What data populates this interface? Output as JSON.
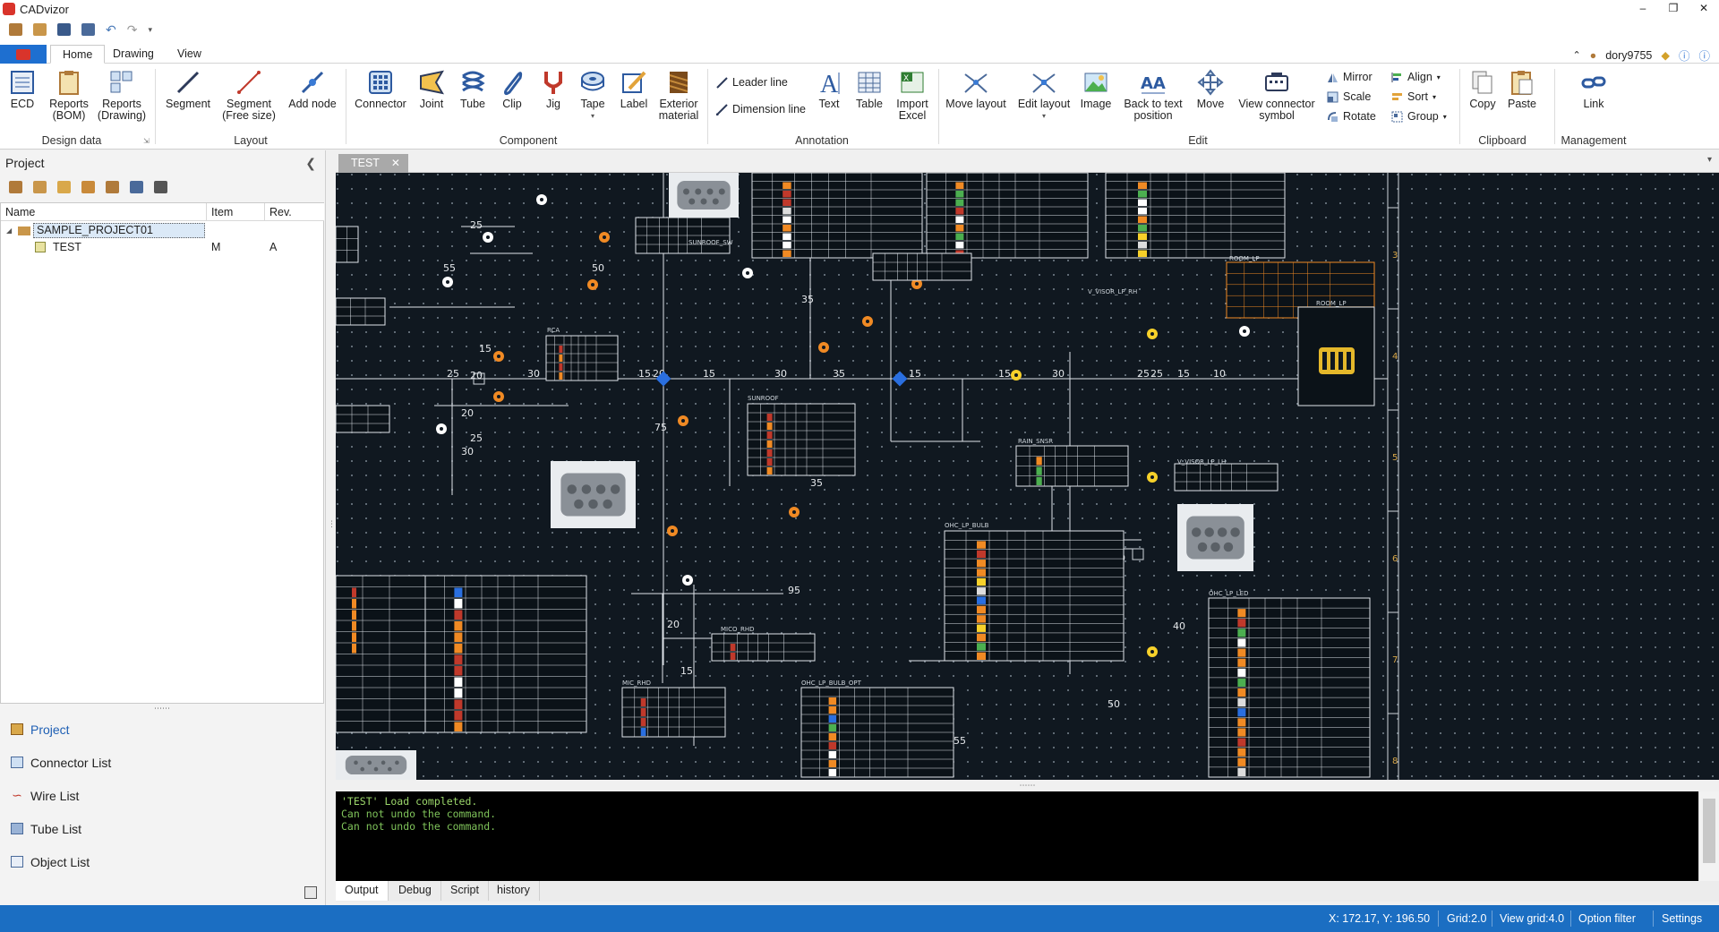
{
  "app": {
    "title": "CADvizor"
  },
  "ribbon_tabs": [
    "Home",
    "Drawing",
    "View"
  ],
  "user": {
    "name": "dory9755"
  },
  "ribbon": {
    "design_data": {
      "label": "Design data",
      "ecd": "ECD",
      "reports_bom": "Reports\n(BOM)",
      "reports_drawing": "Reports\n(Drawing)"
    },
    "layout": {
      "label": "Layout",
      "segment": "Segment",
      "segment_free": "Segment\n(Free size)",
      "add_node": "Add node"
    },
    "component": {
      "label": "Component",
      "connector": "Connector",
      "joint": "Joint",
      "tube": "Tube",
      "clip": "Clip",
      "jig": "Jig",
      "tape": "Tape",
      "label_btn": "Label",
      "exterior": "Exterior\nmaterial"
    },
    "annotation": {
      "label": "Annotation",
      "leader_line": "Leader line",
      "dimension_line": "Dimension line",
      "text": "Text",
      "table": "Table",
      "import_excel": "Import\nExcel"
    },
    "edit": {
      "label": "Edit",
      "move_layout": "Move layout",
      "edit_layout": "Edit layout",
      "image": "Image",
      "back_to_text": "Back to text\nposition",
      "move": "Move",
      "view_connector_symbol": "View connector\nsymbol",
      "mirror": "Mirror",
      "scale": "Scale",
      "rotate": "Rotate",
      "align": "Align",
      "sort": "Sort",
      "group": "Group"
    },
    "clipboard": {
      "label": "Clipboard",
      "copy": "Copy",
      "paste": "Paste"
    },
    "management": {
      "label": "Management",
      "link": "Link"
    }
  },
  "project_panel": {
    "title": "Project",
    "columns": [
      "Name",
      "Item",
      "Rev."
    ],
    "rows": [
      {
        "name": "SAMPLE_PROJECT01",
        "item": "",
        "rev": ""
      },
      {
        "name": "TEST",
        "item": "M",
        "rev": "A"
      }
    ],
    "nav": [
      "Project",
      "Connector List",
      "Wire List",
      "Tube List",
      "Object List"
    ]
  },
  "document": {
    "tab": "TEST"
  },
  "canvas": {
    "dims": [
      "25",
      "30",
      "30",
      "20",
      "55",
      "50",
      "25",
      "35",
      "15",
      "15",
      "20",
      "30",
      "25",
      "15",
      "20",
      "15",
      "30",
      "35",
      "75",
      "35",
      "15",
      "15",
      "30",
      "25",
      "25",
      "15",
      "10",
      "40",
      "25",
      "95",
      "20",
      "15",
      "20",
      "50",
      "40",
      "50",
      "55"
    ],
    "ruler": [
      "3",
      "4",
      "5",
      "6",
      "7",
      "8"
    ],
    "labels": [
      "SUNROOF_SW",
      "ROOM_LP",
      "RCA",
      "RAIN_SNSR",
      "SUNROOF",
      "OHC_LP_BULB",
      "OHC_LP_LED",
      "V_VISOR_LP_LH",
      "V_VISOR_LP_RH",
      "MICO_RHD",
      "MIC_RHD",
      "OHC_LP_BULB_OPT",
      "ROOM_LP"
    ]
  },
  "output": {
    "lines": [
      "'TEST' Load completed.",
      "Can not undo the command.",
      "Can not undo the command."
    ],
    "tabs": [
      "Output",
      "Debug",
      "Script",
      "history"
    ]
  },
  "status": {
    "coords": "X: 172.17, Y: 196.50",
    "grid": "Grid:2.0",
    "view_grid": "View grid:4.0",
    "option_filter": "Option filter",
    "settings": "Settings"
  }
}
